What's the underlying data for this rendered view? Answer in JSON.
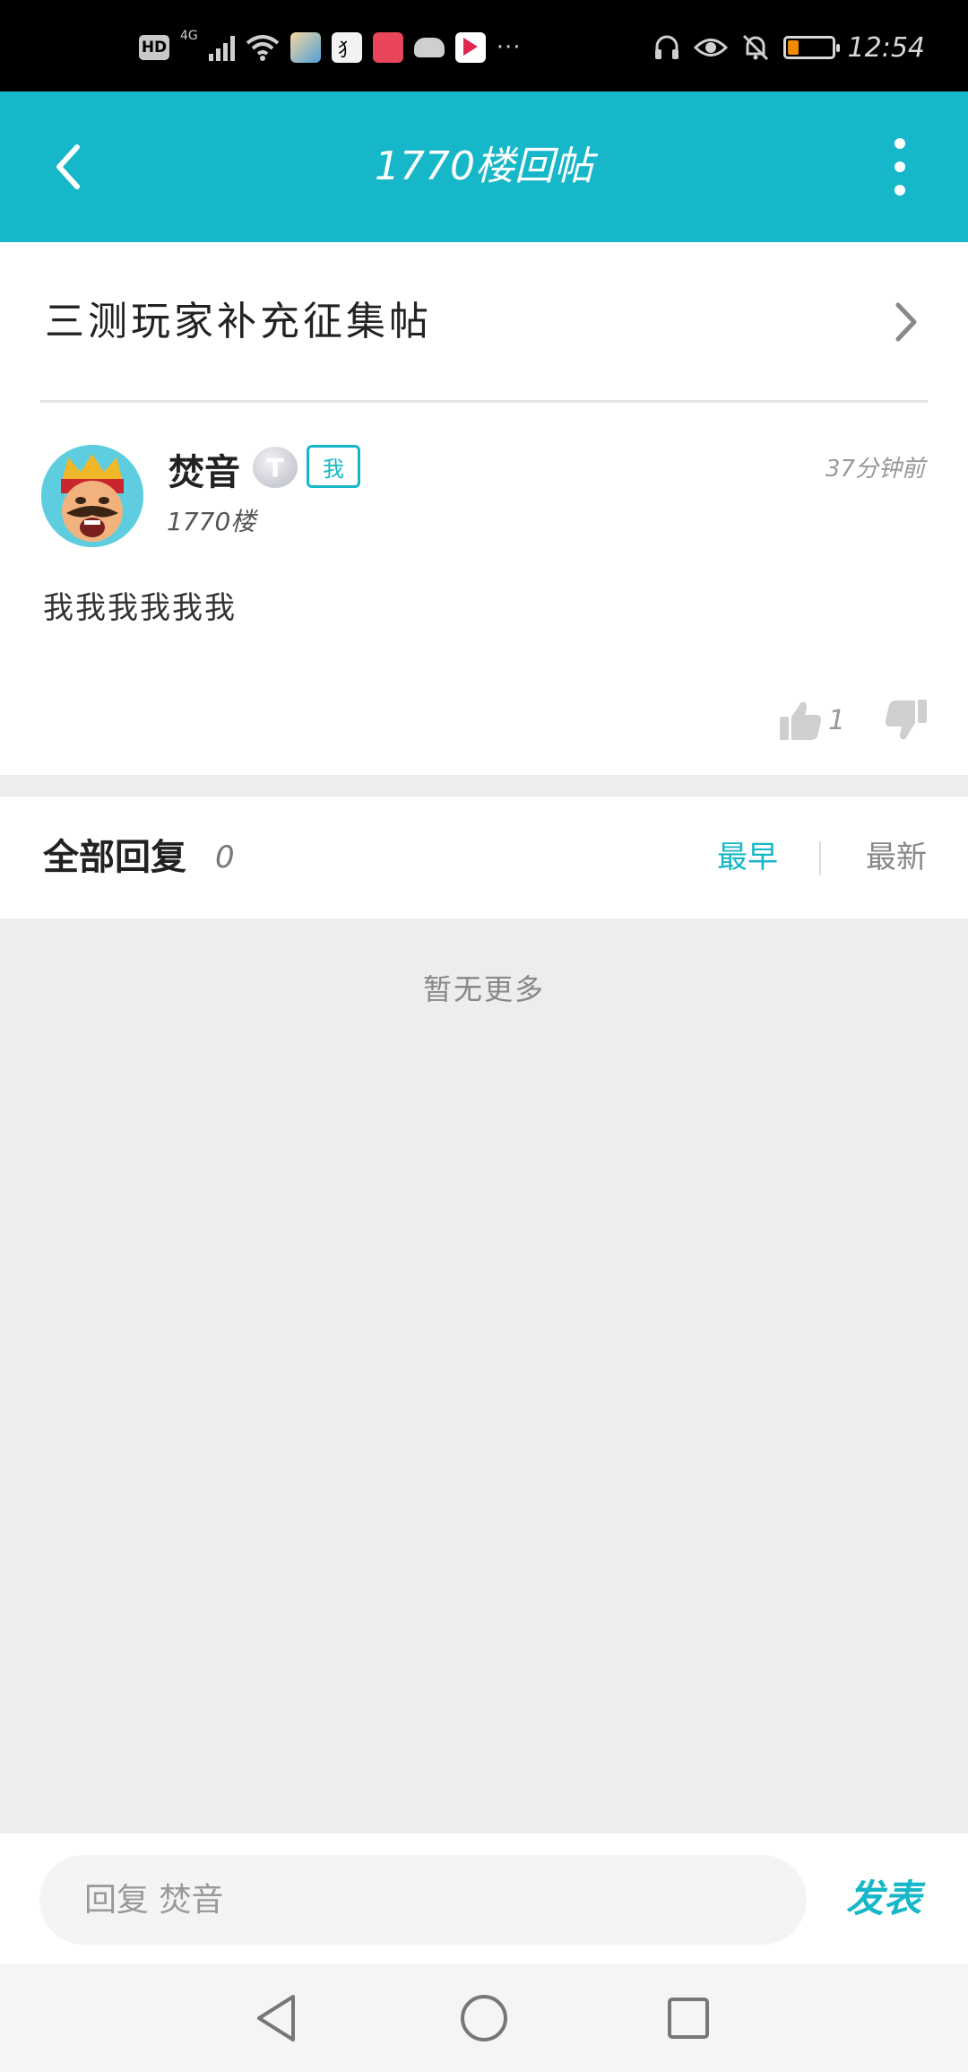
{
  "status_bar": {
    "hd": "HD",
    "network": "4G",
    "app_icon_2_text": "犭",
    "more": "···",
    "time": "12:54",
    "icons": [
      "headset-icon",
      "eye-icon",
      "bell-off-icon",
      "battery-icon"
    ]
  },
  "app_bar": {
    "title": "1770楼回帖"
  },
  "topic": {
    "title": "三测玩家补充征集帖"
  },
  "post": {
    "username": "焚音",
    "level": "T",
    "me_badge": "我",
    "floor": "1770楼",
    "time": "37分钟前",
    "content": "我我我我我我",
    "like_count": "1"
  },
  "replies": {
    "title": "全部回复",
    "count": "0",
    "sort_earliest": "最早",
    "sort_latest": "最新",
    "empty_text": "暂无更多"
  },
  "input": {
    "placeholder": "回复 焚音",
    "send_label": "发表"
  },
  "colors": {
    "accent": "#16b7c8",
    "background": "#ededed"
  }
}
